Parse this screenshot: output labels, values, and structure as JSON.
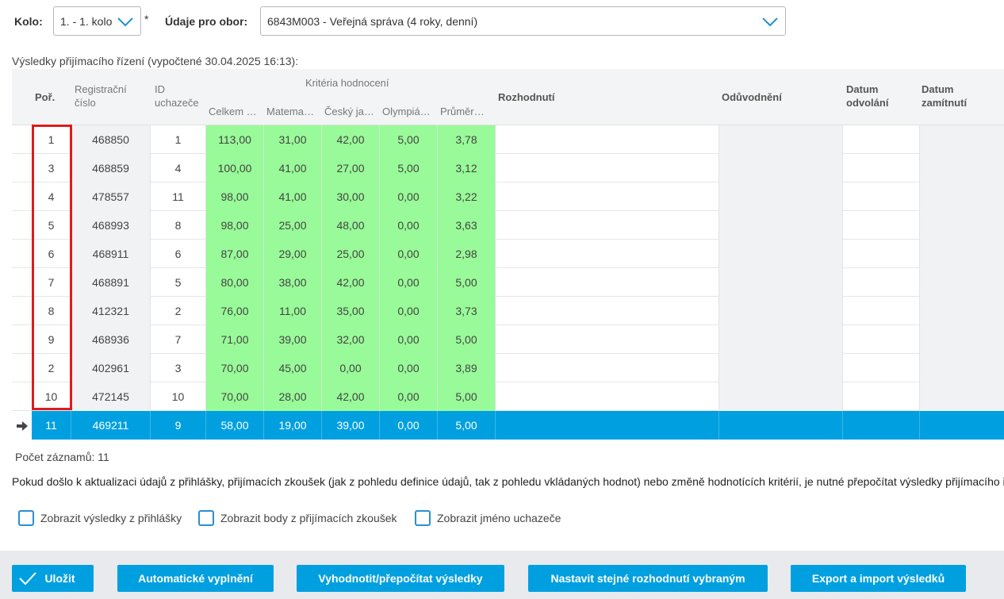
{
  "filters": {
    "kolo_label": "Kolo:",
    "kolo_value": "1. - 1. kolo",
    "required_mark": "*",
    "obor_label": "Údaje pro obor:",
    "obor_value": "6843M003 - Veřejná správa (4 roky, denní)"
  },
  "results_title": "Výsledky přijímacího řízení (vypočtené 30.04.2025 16:13):",
  "table": {
    "headers": {
      "por": "Poř.",
      "reg1": "Registrační",
      "reg2": "číslo",
      "id1": "ID",
      "id2": "uchazeče",
      "kriteria": "Kritéria hodnocení",
      "k1": "Celkem …",
      "k2": "Matema…",
      "k3": "Český ja…",
      "k4": "Olympiá…",
      "k5": "Průměr…",
      "rozhodnuti": "Rozhodnutí",
      "oduvodneni": "Odůvodnění",
      "odvolani1": "Datum",
      "odvolani2": "odvolání",
      "zamitnuti1": "Datum",
      "zamitnuti2": "zamítnutí"
    },
    "rows": [
      {
        "por": "1",
        "reg": "468850",
        "id": "1",
        "k1": "113,00",
        "k2": "31,00",
        "k3": "42,00",
        "k4": "5,00",
        "k5": "3,78"
      },
      {
        "por": "3",
        "reg": "468859",
        "id": "4",
        "k1": "100,00",
        "k2": "41,00",
        "k3": "27,00",
        "k4": "5,00",
        "k5": "3,12"
      },
      {
        "por": "4",
        "reg": "478557",
        "id": "11",
        "k1": "98,00",
        "k2": "41,00",
        "k3": "30,00",
        "k4": "0,00",
        "k5": "3,22"
      },
      {
        "por": "5",
        "reg": "468993",
        "id": "8",
        "k1": "98,00",
        "k2": "25,00",
        "k3": "48,00",
        "k4": "0,00",
        "k5": "3,63"
      },
      {
        "por": "6",
        "reg": "468911",
        "id": "6",
        "k1": "87,00",
        "k2": "29,00",
        "k3": "25,00",
        "k4": "0,00",
        "k5": "2,98"
      },
      {
        "por": "7",
        "reg": "468891",
        "id": "5",
        "k1": "80,00",
        "k2": "38,00",
        "k3": "42,00",
        "k4": "0,00",
        "k5": "5,00"
      },
      {
        "por": "8",
        "reg": "412321",
        "id": "2",
        "k1": "76,00",
        "k2": "11,00",
        "k3": "35,00",
        "k4": "0,00",
        "k5": "3,73"
      },
      {
        "por": "9",
        "reg": "468936",
        "id": "7",
        "k1": "71,00",
        "k2": "39,00",
        "k3": "32,00",
        "k4": "0,00",
        "k5": "5,00"
      },
      {
        "por": "2",
        "reg": "402961",
        "id": "3",
        "k1": "70,00",
        "k2": "45,00",
        "k3": "0,00",
        "k4": "0,00",
        "k5": "3,89"
      },
      {
        "por": "10",
        "reg": "472145",
        "id": "10",
        "k1": "70,00",
        "k2": "28,00",
        "k3": "42,00",
        "k4": "0,00",
        "k5": "5,00"
      },
      {
        "por": "11",
        "reg": "469211",
        "id": "9",
        "k1": "58,00",
        "k2": "19,00",
        "k3": "39,00",
        "k4": "0,00",
        "k5": "5,00",
        "selected": true
      }
    ]
  },
  "record_count": "Počet záznamů: 11",
  "notice": "Pokud došlo k aktualizaci údajů z přihlášky, přijímacích zkoušek (jak z pohledu definice údajů, tak z pohledu vkládaných hodnot) nebo změně hodnotících kritérií, je nutné přepočítat výsledky přijímacího řízení.",
  "checkboxes": {
    "show_results": "Zobrazit výsledky z přihlášky",
    "show_points": "Zobrazit body z přijímacích zkoušek",
    "show_name": "Zobrazit jméno uchazeče"
  },
  "buttons": {
    "save": "Uložit",
    "autofill": "Automatické vyplnění",
    "evaluate": "Vyhodnotit/přepočítat výsledky",
    "same_decision": "Nastavit stejné rozhodnutí vybraným",
    "export": "Export a import výsledků"
  },
  "colors": {
    "accent": "#00a0e0",
    "criteria_green": "#98fa98",
    "highlight_red": "#e01b1b"
  }
}
